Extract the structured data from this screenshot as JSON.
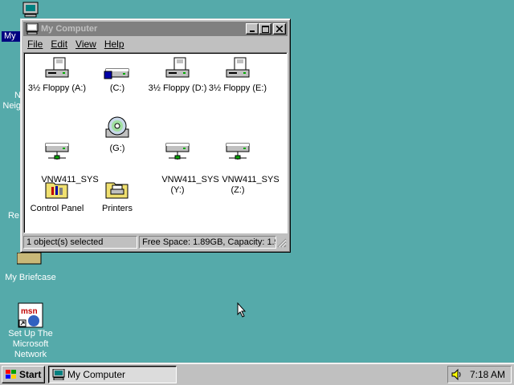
{
  "desktop": {
    "icons": [
      {
        "label": "My"
      },
      {
        "label": "N\nNeig"
      },
      {
        "label": "Re"
      },
      {
        "label": "My Briefcase"
      },
      {
        "label": "Set Up The\nMicrosoft\nNetwork"
      }
    ]
  },
  "window": {
    "title": "My Computer",
    "menu": [
      "File",
      "Edit",
      "View",
      "Help"
    ],
    "items": [
      {
        "label": "3½ Floppy (A:)",
        "icon": "floppy-drive-icon"
      },
      {
        "label": "(C:)",
        "icon": "hard-drive-icon"
      },
      {
        "label": "3½ Floppy (D:)",
        "icon": "floppy-drive-icon"
      },
      {
        "label": "3½ Floppy (E:)",
        "icon": "floppy-drive-icon"
      },
      {
        "label": "VNW411_SYS\n(F:)",
        "icon": "network-drive-icon"
      },
      {
        "label": "(G:)",
        "icon": "cd-rom-drive-icon"
      },
      {
        "label": "VNW411_SYS\n(Y:)",
        "icon": "network-drive-icon"
      },
      {
        "label": "VNW411_SYS\n(Z:)",
        "icon": "network-drive-icon"
      },
      {
        "label": "Control Panel",
        "icon": "control-panel-folder-icon"
      },
      {
        "label": "Printers",
        "icon": "printers-folder-icon"
      }
    ],
    "status": {
      "selected": "1 object(s) selected",
      "space": "Free Space: 1.89GB,  Capacity: 1.9"
    }
  },
  "taskbar": {
    "start_label": "Start",
    "task_label": "My Computer",
    "clock": "7:18 AM"
  }
}
